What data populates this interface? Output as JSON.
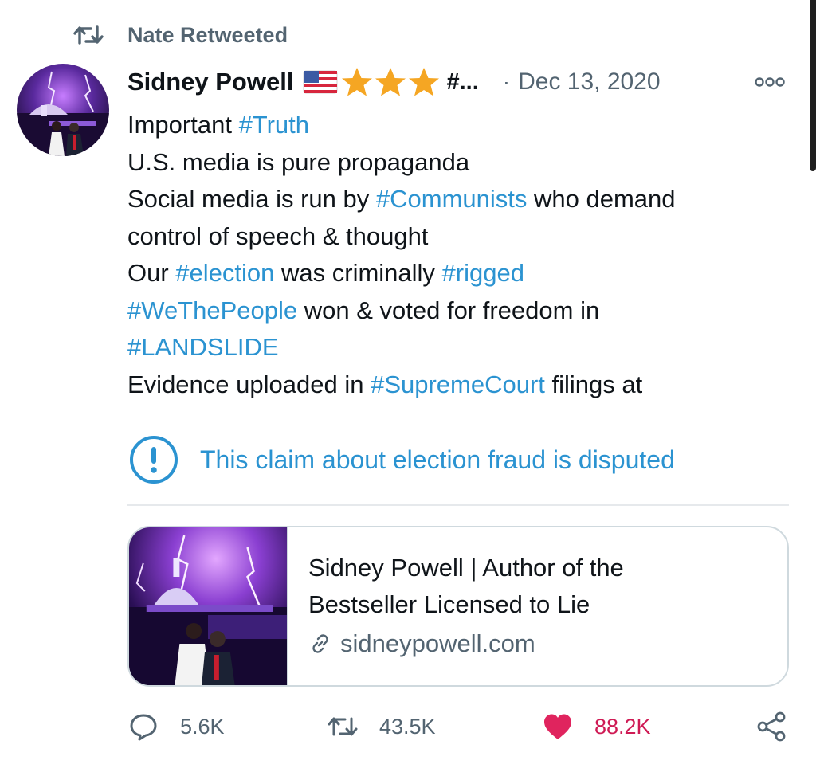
{
  "retweet_context": {
    "text": "Nate Retweeted"
  },
  "author": {
    "name": "Sidney Powell",
    "name_overflow": "#...",
    "date": "Dec 13, 2020",
    "separator": "·",
    "emoji_icons": [
      "us-flag-icon",
      "star-icon",
      "star-icon",
      "star-icon"
    ]
  },
  "tweet": {
    "lines": [
      [
        {
          "t": "Important ",
          "tag": false
        },
        {
          "t": "#Truth",
          "tag": true
        }
      ],
      [
        {
          "t": "U.S. media is pure propaganda",
          "tag": false
        }
      ],
      [
        {
          "t": "Social media is run by ",
          "tag": false
        },
        {
          "t": "#Communists",
          "tag": true
        },
        {
          "t": " who demand",
          "tag": false
        }
      ],
      [
        {
          "t": "control of speech & thought",
          "tag": false
        }
      ],
      [
        {
          "t": "Our ",
          "tag": false
        },
        {
          "t": "#election",
          "tag": true
        },
        {
          "t": " was criminally ",
          "tag": false
        },
        {
          "t": "#rigged",
          "tag": true
        }
      ],
      [
        {
          "t": "#WeThePeople",
          "tag": true
        },
        {
          "t": " won & voted for freedom in",
          "tag": false
        }
      ],
      [
        {
          "t": "#LANDSLIDE",
          "tag": true
        }
      ],
      [
        {
          "t": "Evidence uploaded in ",
          "tag": false
        },
        {
          "t": "#SupremeCourt",
          "tag": true
        },
        {
          "t": " filings at",
          "tag": false
        }
      ]
    ]
  },
  "notice": {
    "text": "This claim about election fraud is disputed"
  },
  "link_card": {
    "title_line1": "Sidney Powell | Author of the",
    "title_line2": "Bestseller Licensed to Lie",
    "domain": "sidneypowell.com"
  },
  "actions": {
    "replies": "5.6K",
    "retweets": "43.5K",
    "likes": "88.2K"
  },
  "colors": {
    "hashtag": "#2b93d1",
    "secondary_text": "#536471",
    "like_active": "#e0245e",
    "star": "#f5a623"
  }
}
